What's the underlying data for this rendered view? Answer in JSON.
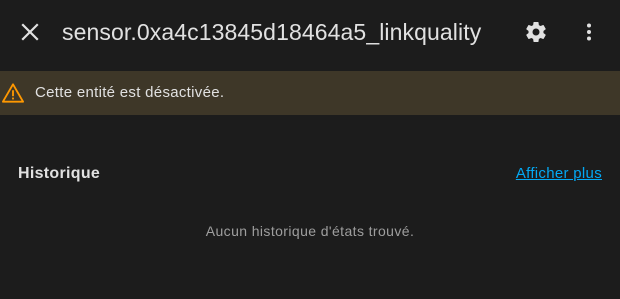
{
  "dialog": {
    "title": "sensor.0xa4c13845d18464a5_linkquality",
    "icons": {
      "close": "close-icon",
      "settings": "gear-icon",
      "menu": "more-vertical-icon"
    }
  },
  "alert": {
    "icon": "warning-icon",
    "text": "Cette entité est désactivée.",
    "icon_color": "#ff9800",
    "background": "#3e3728"
  },
  "history": {
    "title": "Historique",
    "more_link": "Afficher plus",
    "empty_text": "Aucun historique d'états trouvé.",
    "link_color": "#03a9f4"
  }
}
